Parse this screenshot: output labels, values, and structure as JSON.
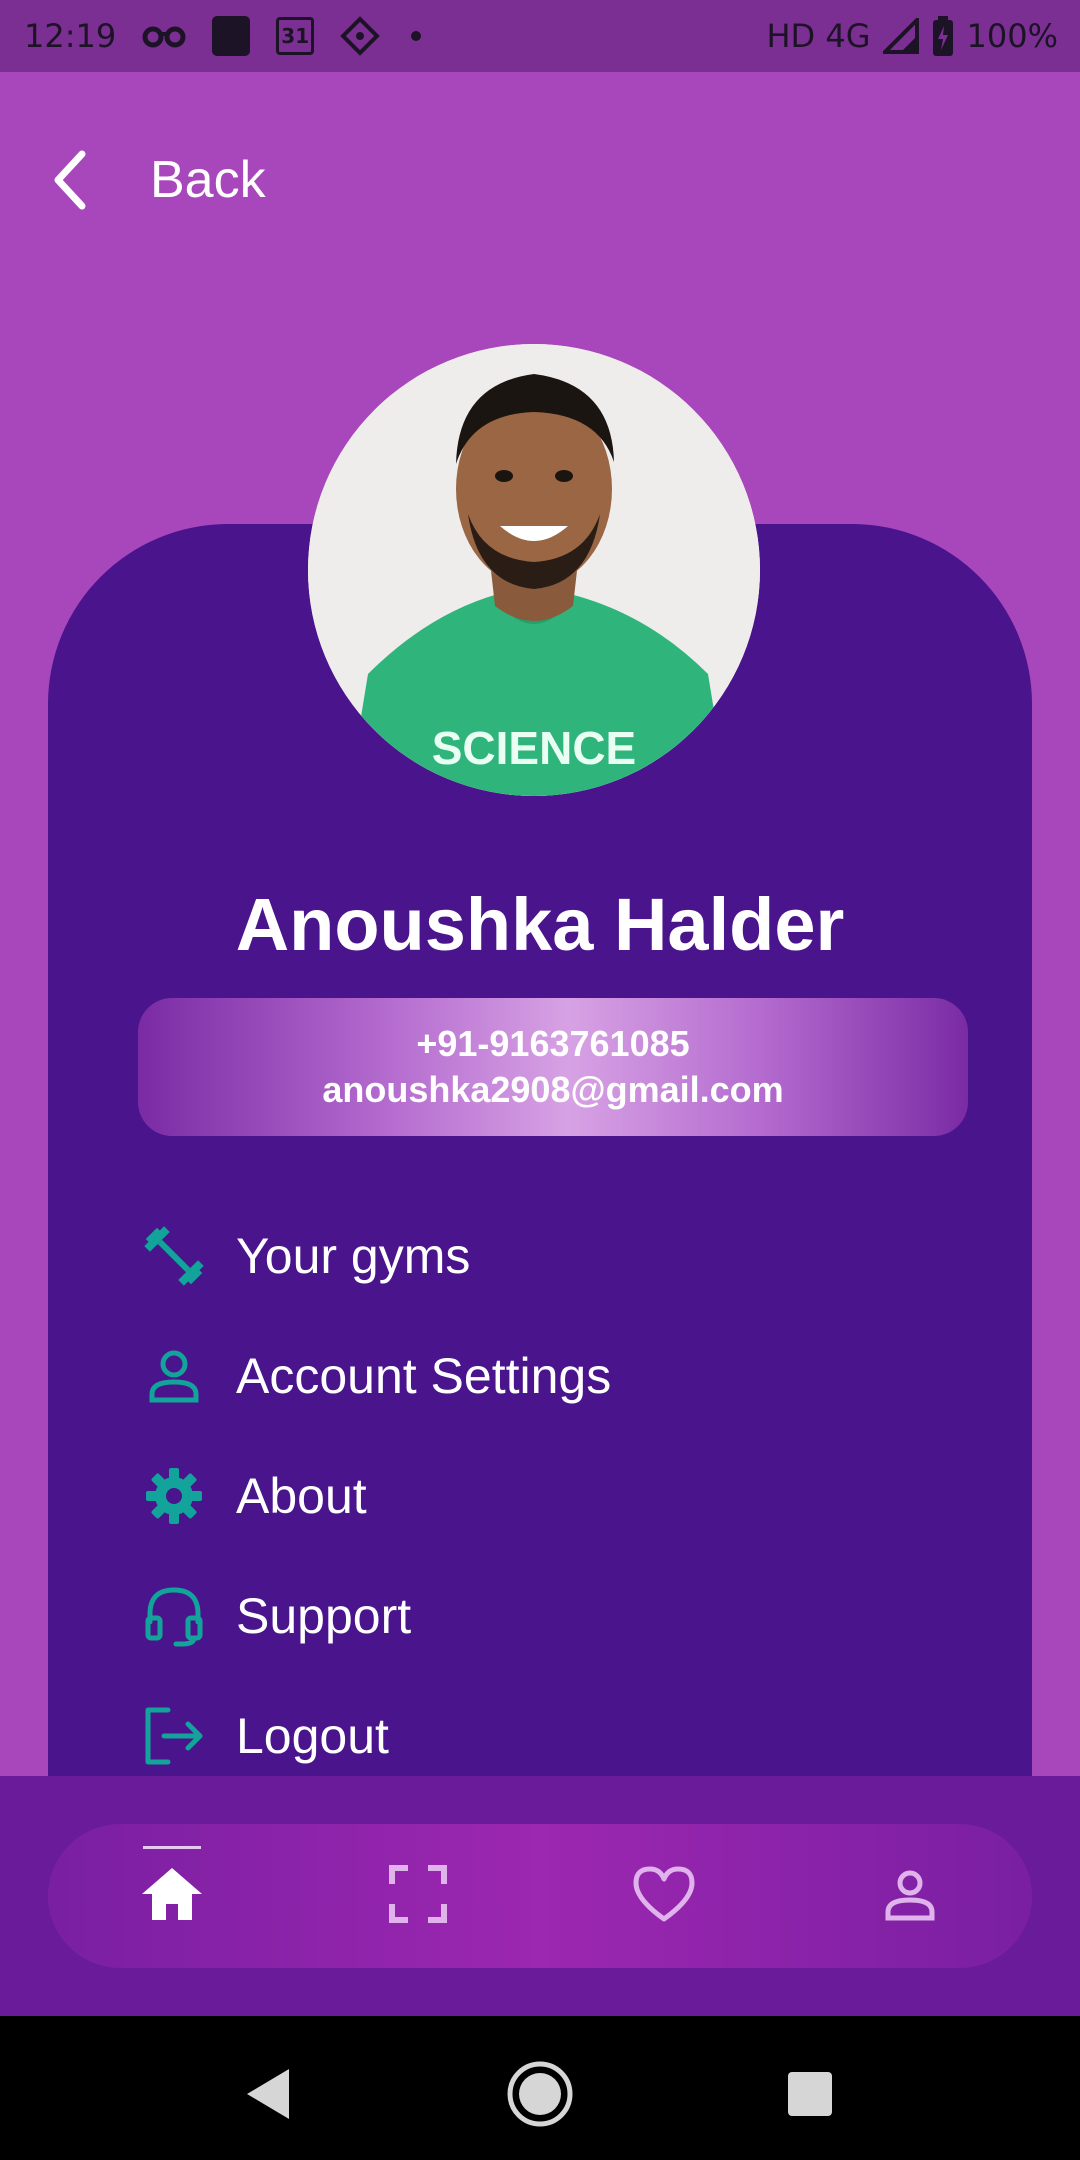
{
  "status_bar": {
    "time": "12:19",
    "calendar_day": "31",
    "network": "HD 4G",
    "battery": "100%",
    "icons": [
      "glasses-icon",
      "notes-icon",
      "calendar-icon",
      "sim-icon",
      "dot-icon",
      "signal-icon",
      "battery-icon"
    ]
  },
  "header": {
    "back_label": "Back"
  },
  "profile": {
    "name": "Anoushka Halder",
    "phone": "+91-9163761085",
    "email": "anoushka2908@gmail.com"
  },
  "menu": [
    {
      "label": "Your gyms",
      "icon": "dumbbell-icon"
    },
    {
      "label": "Account Settings",
      "icon": "person-icon"
    },
    {
      "label": "About",
      "icon": "gear-icon"
    },
    {
      "label": "Support",
      "icon": "headset-icon"
    },
    {
      "label": "Logout",
      "icon": "logout-icon"
    }
  ],
  "bottom_nav": [
    "home-icon",
    "scan-icon",
    "heart-icon",
    "profile-icon"
  ],
  "colors": {
    "background": "#A846BC",
    "card": "#4A148C",
    "accent_icon": "#12A39A",
    "nav": "#6A1B9A"
  }
}
